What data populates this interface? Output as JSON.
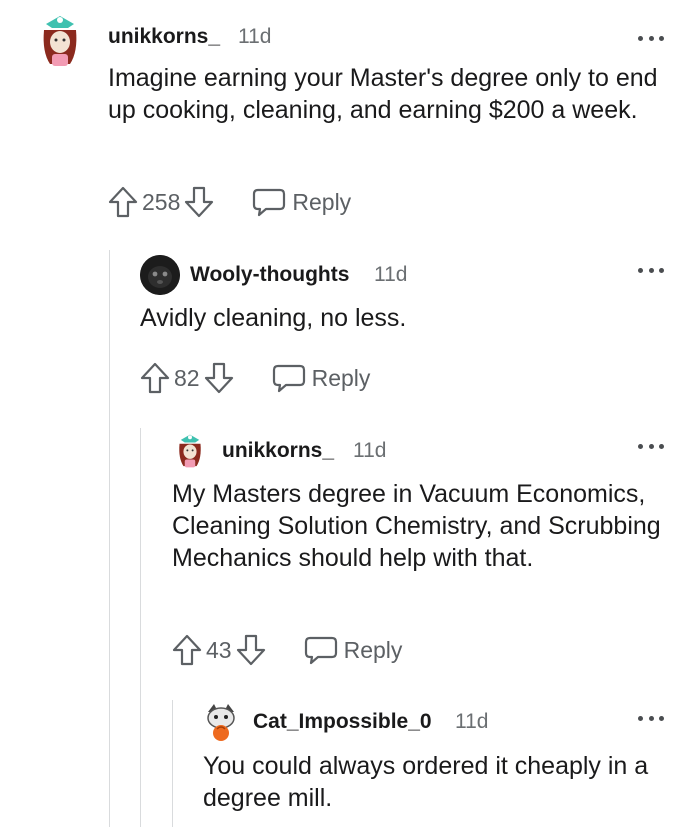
{
  "comments": [
    {
      "username": "unikkorns_",
      "time": "11d",
      "body": "Imagine earning your Master's degree only to end up cooking, cleaning, and earning $200 a week.",
      "votes": "258",
      "reply_label": "Reply",
      "avatar_icon": "unicorn-avatar"
    },
    {
      "username": "Wooly-thoughts",
      "time": "11d",
      "body": "Avidly cleaning, no less.",
      "votes": "82",
      "reply_label": "Reply",
      "avatar_icon": "dog-avatar"
    },
    {
      "username": "unikkorns_",
      "time": "11d",
      "body": "My Masters degree in Vacuum Economics, Cleaning Solution Chemistry, and Scrubbing Mechanics should help with that.",
      "votes": "43",
      "reply_label": "Reply",
      "avatar_icon": "unicorn-avatar"
    },
    {
      "username": "Cat_Impossible_0",
      "time": "11d",
      "body": "You could always ordered it cheaply in a degree mill.",
      "avatar_icon": "cat-avatar"
    }
  ],
  "colors": {
    "text": "#1a1a1b",
    "muted": "#6b6f72",
    "thread_line": "#d9dbdd",
    "icon": "#5c6064"
  },
  "icons": [
    "more-options-icon",
    "upvote-icon",
    "downvote-icon",
    "reply-bubble-icon"
  ]
}
